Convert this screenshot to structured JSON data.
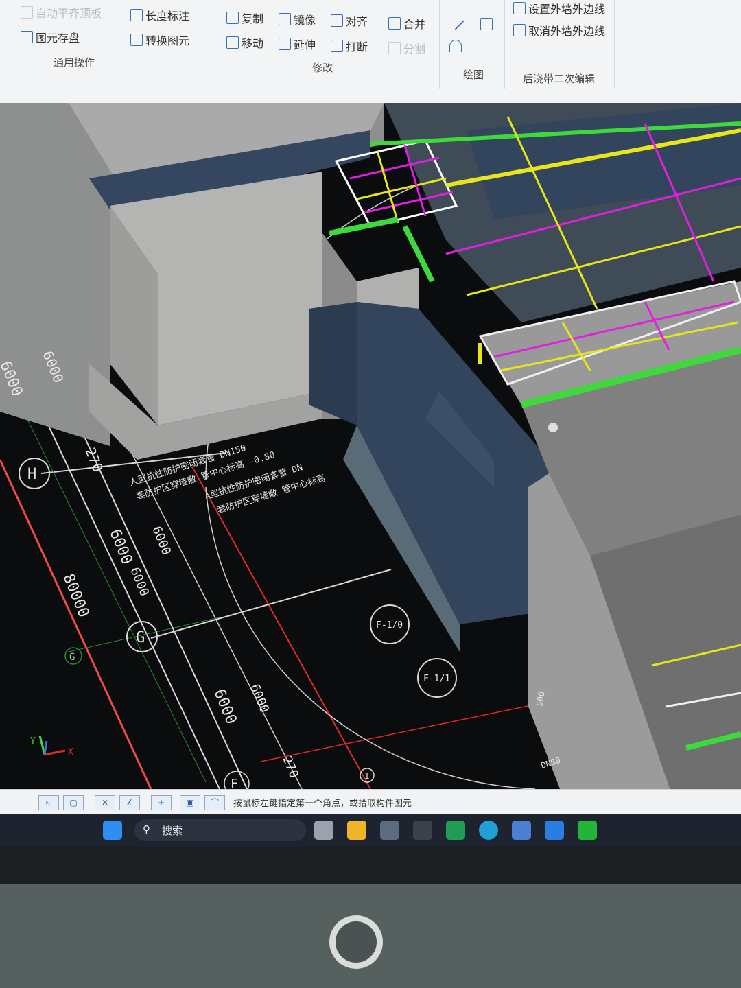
{
  "ribbon": {
    "top_row": [
      {
        "label": "自动平齐顶板",
        "icon": "align-top-icon",
        "faded": true
      },
      {
        "label": "长度标注",
        "icon": "dimension-icon"
      },
      {
        "label": "复制",
        "icon": "copy-icon"
      },
      {
        "label": "镜像",
        "icon": "mirror-icon"
      },
      {
        "label": "对齐",
        "icon": "align-icon"
      },
      {
        "label": "合并",
        "icon": "merge-icon"
      },
      {
        "label": "设置外墙外边线",
        "icon": "set-outer-line-icon"
      }
    ],
    "second_row": [
      {
        "label": "图元存盘",
        "icon": "save-element-icon"
      },
      {
        "label": "转换图元",
        "icon": "convert-element-icon"
      },
      {
        "label": "移动",
        "icon": "move-icon"
      },
      {
        "label": "延伸",
        "icon": "extend-icon"
      },
      {
        "label": "打断",
        "icon": "break-icon"
      },
      {
        "label": "分割",
        "icon": "split-icon",
        "faded": true
      },
      {
        "label": "取消外墙外边线",
        "icon": "cancel-outer-line-icon"
      }
    ],
    "groups": {
      "common": "通用操作",
      "modify": "修改",
      "draw": "绘图",
      "post_pour": "后浇带二次编辑"
    }
  },
  "cad": {
    "axis_labels": [
      "H",
      "G",
      "G",
      "F"
    ],
    "circle_markers": [
      "F-1/0",
      "F-1/1"
    ],
    "marker_1": "1",
    "dims": [
      "6000",
      "6000",
      "6000",
      "6000",
      "80000",
      "6000",
      "6000",
      "6000",
      "270",
      "270"
    ],
    "annot_line1": "人型抗性防护密闭套管 DN150",
    "annot_line2": "套防护区穿墙敷 管中心标高 -0.80",
    "annot_line3": "A型抗性防护密闭套管 DN",
    "annot_line4": "套防护区穿墙敷 管中心标高",
    "annot_line5": "DN80",
    "annot_side": "500",
    "axis_x": "X",
    "axis_y": "Y"
  },
  "status": {
    "hint": "按鼠标左键指定第一个角点，或拾取构件图元"
  },
  "taskbar": {
    "search_placeholder": "搜索",
    "apps": [
      "start-icon",
      "search-icon",
      "file-explorer-icon",
      "folder-icon",
      "store-icon",
      "app-icon",
      "mail-icon",
      "edge-icon",
      "calculator-icon",
      "tencent-icon",
      "wechat-icon"
    ]
  },
  "colors": {
    "ribbon_bg": "#f3f4f5",
    "viewport_bg": "#0b0c0e",
    "wall_gray": "#a8a9a8",
    "wall_blue": "#34465e",
    "rebar_yellow": "#e6e61a",
    "rebar_magenta": "#e21fe0",
    "rebar_green": "#3ed93a",
    "grid_red": "#e02a2a"
  }
}
